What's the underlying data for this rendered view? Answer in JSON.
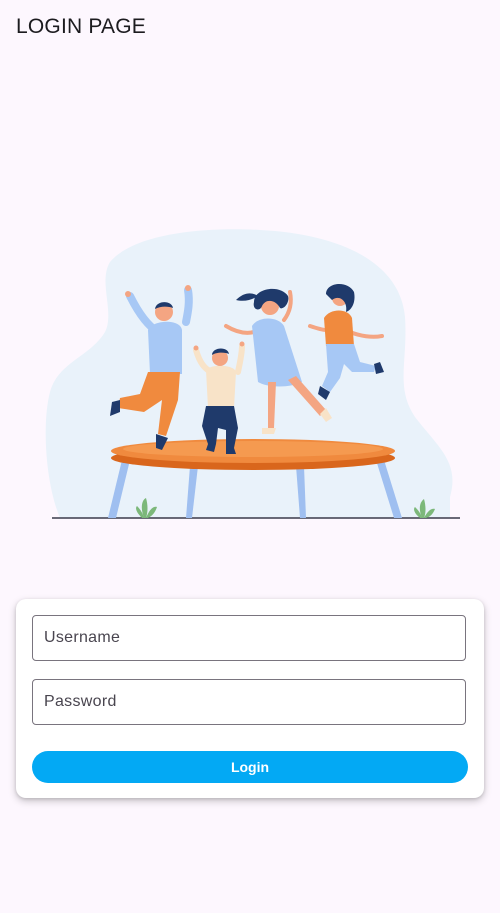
{
  "app_bar": {
    "title": "LOGIN PAGE"
  },
  "illustration": {
    "icon": "people-jumping-on-trampoline-illustration"
  },
  "form": {
    "username_placeholder": "Username",
    "password_placeholder": "Password",
    "login_label": "Login"
  },
  "colors": {
    "background": "#fdf7fe",
    "accent": "#03a9f4",
    "blob": "#e9f2fa",
    "trampoline": "#f08a3e"
  }
}
